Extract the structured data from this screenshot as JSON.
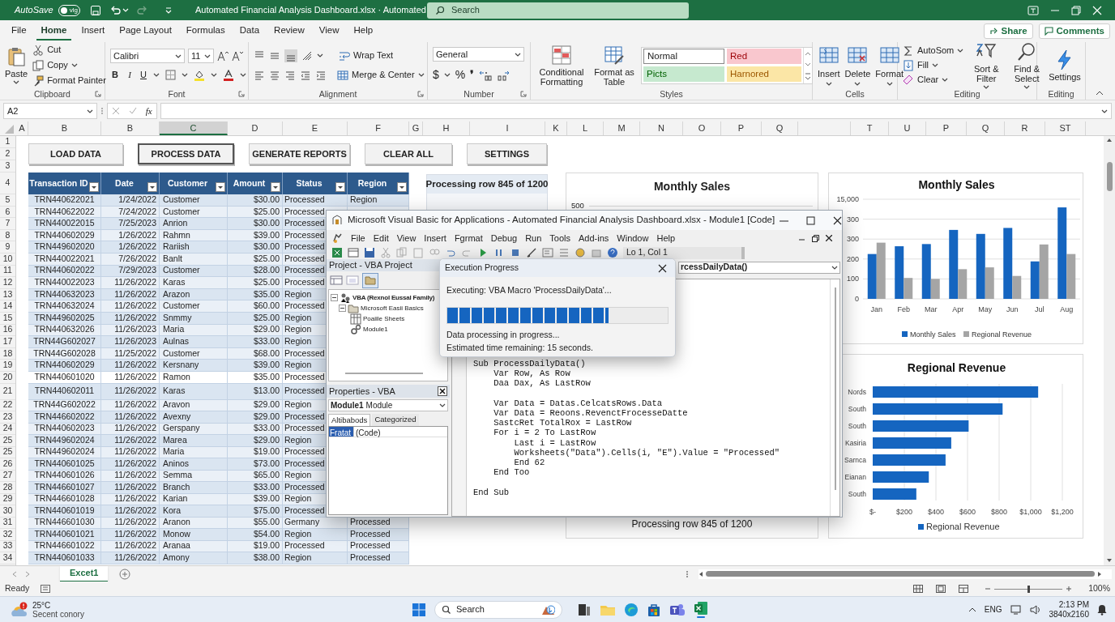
{
  "title_bar": {
    "autosave_label": "AutoSave",
    "autosave_toggle": "vlg",
    "autosave_on": false,
    "file_title": "Automated Financial Analysis Dashboard.xlsx · Automated",
    "search_placeholder": "Search"
  },
  "ribbon_tabs": [
    {
      "label": "File",
      "selected": false
    },
    {
      "label": "Home",
      "selected": true
    },
    {
      "label": "Insert",
      "selected": false
    },
    {
      "label": "Page Layout",
      "selected": false
    },
    {
      "label": "Formulas",
      "selected": false
    },
    {
      "label": "Data",
      "selected": false
    },
    {
      "label": "Review",
      "selected": false
    },
    {
      "label": "View",
      "selected": false
    },
    {
      "label": "Help",
      "selected": false
    }
  ],
  "share": "Share",
  "comments": "Comments",
  "ribbon": {
    "clipboard": {
      "paste": "Paste",
      "cut": "Cut",
      "copy": "Copy",
      "format_painter": "Format Painter",
      "label": "Clipboard"
    },
    "font": {
      "name": "Calibri",
      "size": "11",
      "bold": "B",
      "italic": "I",
      "underline": "U",
      "label": "Font"
    },
    "alignment": {
      "wrap": "Wrap Text",
      "merge": "Merge & Center",
      "label": "Alignment"
    },
    "number": {
      "format": "General",
      "currency": "$",
      "percent": "%",
      "comma": "❜",
      "label": "Number"
    },
    "styles": {
      "conditional": "Conditional Formatting",
      "format_table": "Format as Table",
      "label": "Styles",
      "cell_styles": [
        {
          "label": "Normal",
          "kind": "normal",
          "color": "#ffffff"
        },
        {
          "label": "Red",
          "kind": "bad",
          "color": "#f9c7ce"
        },
        {
          "label": "Picts",
          "kind": "good",
          "color": "#c6e9cf"
        },
        {
          "label": "Harnored",
          "kind": "neutral",
          "color": "#fbe6a6"
        }
      ]
    },
    "cells": {
      "insert": "Insert",
      "delete": "Delete",
      "format": "Format",
      "label": "Cells"
    },
    "editing": {
      "autosum": "AutoSom",
      "fill": "Fill",
      "clear": "Clear",
      "sort": "Sort & Filter",
      "find": "Find & Select",
      "label": "Editing"
    },
    "settings": {
      "button": "Settings",
      "label": "Editing"
    }
  },
  "formula_bar": {
    "name_box": "A2",
    "fx": "fx"
  },
  "columns": [
    {
      "letter": "A",
      "selected": false
    },
    {
      "letter": "B",
      "selected": false
    },
    {
      "letter": "B",
      "selected": false
    },
    {
      "letter": "C",
      "selected": true
    },
    {
      "letter": "D",
      "selected": false
    },
    {
      "letter": "E",
      "selected": false
    },
    {
      "letter": "F",
      "selected": false
    },
    {
      "letter": "G",
      "selected": false
    },
    {
      "letter": "H",
      "selected": false
    },
    {
      "letter": "I",
      "selected": false
    },
    {
      "letter": "K",
      "selected": false
    },
    {
      "letter": "L",
      "selected": false
    },
    {
      "letter": "M",
      "selected": false
    },
    {
      "letter": "N",
      "selected": false
    },
    {
      "letter": "O",
      "selected": false
    },
    {
      "letter": "P",
      "selected": false
    },
    {
      "letter": "Q",
      "selected": false
    },
    {
      "letter": "T",
      "selected": false
    },
    {
      "letter": "U",
      "selected": false
    },
    {
      "letter": "P",
      "selected": false
    },
    {
      "letter": "Q",
      "selected": false
    },
    {
      "letter": "R",
      "selected": false
    },
    {
      "letter": "ST",
      "selected": false
    }
  ],
  "row_headers": [
    "1",
    "2",
    "3",
    "4",
    "5",
    "6",
    "7",
    "8",
    "9",
    "10",
    "11",
    "12",
    "13",
    "14",
    "15",
    "16",
    "17",
    "18",
    "19",
    "20",
    "21",
    "22",
    "23",
    "24",
    "25",
    "25",
    "26",
    "27",
    "28",
    "29",
    "30",
    "31",
    "32",
    "33",
    "34"
  ],
  "macro_buttons": [
    {
      "label": "LOAD DATA",
      "selected": false
    },
    {
      "label": "PROCESS DATA",
      "selected": true
    },
    {
      "label": "GENERATE REPORTS",
      "selected": false
    },
    {
      "label": "CLEAR ALL",
      "selected": false
    },
    {
      "label": "SETTINGS",
      "selected": false
    }
  ],
  "table": {
    "columns": [
      "Transaction ID",
      "Date",
      "Customer",
      "Amount",
      "Status",
      "Region"
    ],
    "rows": [
      {
        "id": "TRN440622021",
        "date": "1/24/2022",
        "customer": "Customer",
        "amount": "$30.00",
        "status": "Processed",
        "region": "Region"
      },
      {
        "id": "TRN440622022",
        "date": "7/24/2022",
        "customer": "Customer",
        "amount": "$25.00",
        "status": "Processed"
      },
      {
        "id": "TRN440022015",
        "date": "7/25/2023",
        "customer": "Anrion",
        "amount": "$30.00",
        "status": "Processed"
      },
      {
        "id": "TRN440602029",
        "date": "1/26/2022",
        "customer": "Rahmn",
        "amount": "$39.00",
        "status": "Processed"
      },
      {
        "id": "TRN449602020",
        "date": "1/26/2022",
        "customer": "Rariish",
        "amount": "$30.00",
        "status": "Processed"
      },
      {
        "id": "TRN440022021",
        "date": "7/26/2022",
        "customer": "Banlt",
        "amount": "$25.00",
        "status": "Processed"
      },
      {
        "id": "TRN440602022",
        "date": "7/29/2023",
        "customer": "Customer",
        "amount": "$28.00",
        "status": "Processed"
      },
      {
        "id": "TRN440022023",
        "date": "11/26/2022",
        "customer": "Karas",
        "amount": "$25.00",
        "status": "Processed"
      },
      {
        "id": "TRN440632023",
        "date": "11/26/2022",
        "customer": "Arazon",
        "amount": "$35.00",
        "status": "Region"
      },
      {
        "id": "TRN440632024",
        "date": "11/26/2022",
        "customer": "Customer",
        "amount": "$60.00",
        "status": "Processed"
      },
      {
        "id": "TRN449602025",
        "date": "11/26/2022",
        "customer": "Snmmy",
        "amount": "$25.00",
        "status": "Region"
      },
      {
        "id": "TRN440632026",
        "date": "11/26/2023",
        "customer": "Maria",
        "amount": "$29.00",
        "status": "Region"
      },
      {
        "id": "TRN44G602027",
        "date": "11/26/2023",
        "customer": "Aulnas",
        "amount": "$33.00",
        "status": "Region"
      },
      {
        "id": "TRN44G602028",
        "date": "11/25/2022",
        "customer": "Customer",
        "amount": "$68.00",
        "status": "Processed"
      },
      {
        "id": "TRN440602029",
        "date": "11/26/2022",
        "customer": "Kersnany",
        "amount": "$39.00",
        "status": "Region"
      },
      {
        "id": "TRN440601020",
        "date": "11/26/2022",
        "customer": "Ramon",
        "amount": "$35.00",
        "status": "Processed"
      },
      {
        "id": "TRN440602011",
        "date": "11/26/2022",
        "customer": "Karas",
        "amount": "$13.00",
        "status": "Processed"
      },
      {
        "id": "TRN44G602022",
        "date": "11/26/2022",
        "customer": "Aravon",
        "amount": "$29.00",
        "status": "Region"
      },
      {
        "id": "TRN446602022",
        "date": "11/26/2022",
        "customer": "Avexny",
        "amount": "$29.00",
        "status": "Processed"
      },
      {
        "id": "TRN440602023",
        "date": "11/26/2022",
        "customer": "Gerspany",
        "amount": "$33.00",
        "status": "Processed"
      },
      {
        "id": "TRN449602024",
        "date": "11/26/2022",
        "customer": "Marea",
        "amount": "$29.00",
        "status": "Region"
      },
      {
        "id": "TRN449602024",
        "date": "11/26/2022",
        "customer": "Maria",
        "amount": "$19.00",
        "status": "Processed"
      },
      {
        "id": "TRN440601025",
        "date": "11/26/2022",
        "customer": "Aninos",
        "amount": "$73.00",
        "status": "Processed"
      },
      {
        "id": "TRN440601026",
        "date": "11/26/2022",
        "customer": "Semma",
        "amount": "$65.00",
        "status": "Region"
      },
      {
        "id": "TRN446601027",
        "date": "11/26/2022",
        "customer": "Branch",
        "amount": "$33.00",
        "status": "Processed"
      },
      {
        "id": "TRN446601028",
        "date": "11/26/2022",
        "customer": "Karian",
        "amount": "$39.00",
        "status": "Region"
      },
      {
        "id": "TRN440601019",
        "date": "11/26/2022",
        "customer": "Kora",
        "amount": "$75.00",
        "status": "Processed"
      },
      {
        "id": "TRN446601030",
        "date": "11/26/2022",
        "customer": "Aranon",
        "amount": "$55.00",
        "status": "Germany",
        "region": "Processed"
      },
      {
        "id": "TRN440601021",
        "date": "11/26/2022",
        "customer": "Monow",
        "amount": "$54.00",
        "status": "Region",
        "region": "Processed"
      },
      {
        "id": "TRN446601022",
        "date": "11/26/2022",
        "customer": "Aranaa",
        "amount": "$19.00",
        "status": "Processed",
        "region": "Processed"
      },
      {
        "id": "TRN440601033",
        "date": "11/26/2022",
        "customer": "Amony",
        "amount": "$38.00",
        "status": "Region",
        "region": "Processed"
      }
    ]
  },
  "processing_panel": {
    "title": "Processing row 845 of 1200"
  },
  "sales_panel": {
    "title": "Monthly Sales",
    "tick": "500",
    "footer": "Processing row 845 of 1200"
  },
  "charts": [
    {
      "extra_tick_labels": [
        "15,000",
        "300"
      ],
      "chart_data": {
        "type": "bar",
        "title": "Monthly Sales",
        "categories": [
          "Jan",
          "Feb",
          "Mar",
          "Apr",
          "May",
          "Jun",
          "Jul",
          "Aug"
        ],
        "series": [
          {
            "name": "Monthly Sales",
            "color": "#1565c0",
            "values": [
              225,
              264,
              275,
              346,
              326,
              356,
              188,
              459
            ]
          },
          {
            "name": "Regional Revenue",
            "color": "#a5a5a5",
            "values": [
              282,
              105,
              100,
              149,
              158,
              115,
              273,
              225
            ]
          }
        ],
        "ylim": [
          0,
          500
        ],
        "yticks": [
          0,
          100,
          200,
          300
        ],
        "grid": true,
        "legend": "bottom"
      }
    },
    {
      "chart_data": {
        "type": "bar",
        "orientation": "horizontal",
        "title": "Regional Revenue",
        "categories": [
          "Nords",
          "South",
          "South",
          "Kasiria",
          "Sarnca",
          "Eianan",
          "South"
        ],
        "series": [
          {
            "name": "Regional Revenue",
            "color": "#1565c0",
            "values": [
              1047,
              822,
              607,
              497,
              461,
              355,
              276
            ]
          }
        ],
        "xlim": [
          0,
          1200
        ],
        "xticks": [
          {
            "value": 0,
            "label": "$-"
          },
          {
            "value": 200,
            "label": "$200"
          },
          {
            "value": 400,
            "label": "$400"
          },
          {
            "value": 600,
            "label": "$600"
          },
          {
            "value": 800,
            "label": "$800"
          },
          {
            "value": 1000,
            "label": "$1,000"
          },
          {
            "value": 1200,
            "label": "$1,200"
          }
        ],
        "grid": true,
        "legend": "bottom"
      }
    }
  ],
  "vba": {
    "title": "Microsoft Visual Basic for Applications - Automated Financial Analysis Dashboard.xlsx - Module1 [Code]",
    "menu": [
      "File",
      "Edit",
      "View",
      "Insert",
      "Fgrmat",
      "Debug",
      "Run",
      "Tools",
      "Add-ins",
      "Window",
      "Help"
    ],
    "position": "Lo 1, Col 1",
    "project_title": "Project - VBA Project",
    "tree": [
      {
        "label": "VBA (Rexnol Eussal Family)",
        "kind": "project",
        "expanded": true,
        "children": [
          {
            "label": "Microsoft Easii Basics",
            "kind": "folder",
            "expanded": true,
            "children": [
              {
                "label": "Poaiile Sheets",
                "kind": "sheets"
              },
              {
                "label": "Module1",
                "kind": "module"
              }
            ]
          }
        ]
      }
    ],
    "properties_title": "Properties - VBA",
    "object_name": "Module1",
    "object_type": "Module",
    "prop_tabs": [
      {
        "label": "Altibabods",
        "selected": true
      },
      {
        "label": "Categorized",
        "selected": false
      }
    ],
    "prop_rows": [
      {
        "name": "Fratat",
        "value": "(Code)",
        "selected": true
      }
    ],
    "procedure": "rcessDailyData()",
    "code_blocks": [
      [
        "Sub ProcessDailyData()",
        "    Var Row, As Row",
        "    Daa Dax, As LastRow"
      ],
      [
        "    Var Data = Datas.CelcatsRows.Data",
        "    Var Data = Reoons.RevenctFrocesseDatte",
        "    SastcRet TotalRox = LastRow",
        "    For i = 2 To LastRow",
        "        Last i = LastRow",
        "        Worksheets(\"Data\").Cells(i, \"E\").Value = \"Processed\"",
        "        End 62",
        "    End Too"
      ],
      [
        "End Sub"
      ]
    ]
  },
  "progress_dialog": {
    "title": "Execution Progress",
    "message": "Executing: VBA Macro 'ProcessDailyData'...",
    "level": 0.73,
    "status": "Data processing in progress...",
    "remaining": "Estimated time remaining: 15 seconds."
  },
  "sheet_tabs": [
    {
      "label": "Excet1",
      "selected": true
    }
  ],
  "status_bar": {
    "ready": "Ready",
    "zoom": "100%",
    "level": 0.5
  },
  "taskbar": {
    "temperature": "25°C",
    "weather": "Secent conory",
    "search": "Search",
    "language": "ENG",
    "time": "2:13 PM",
    "date": "3840x2160"
  }
}
